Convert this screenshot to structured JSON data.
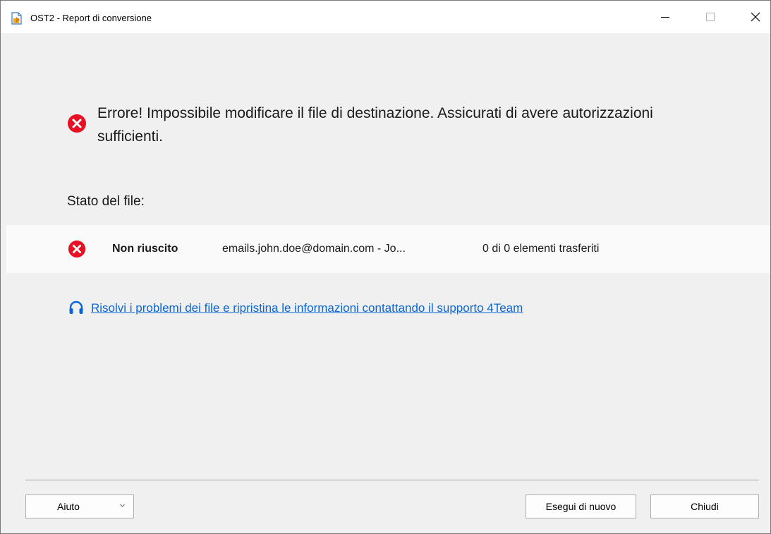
{
  "window": {
    "title": "OST2 - Report di conversione",
    "app_icon": "document-export-icon",
    "controls": [
      "minimize-icon",
      "maximize-icon",
      "close-icon"
    ]
  },
  "error": {
    "icon": "error-circle-icon",
    "message": "Errore! Impossibile modificare il file di destinazione. Assicurati di avere autorizzazioni sufficienti."
  },
  "file_status": {
    "label": "Stato del file:",
    "rows": [
      {
        "icon": "error-circle-icon",
        "status": "Non riuscito",
        "name": "emails.john.doe@domain.com - Jo...",
        "count": "0 di 0 elementi trasferiti"
      }
    ]
  },
  "support": {
    "icon": "headset-icon",
    "link_text": "Risolvi i problemi dei file e ripristina le informazioni contattando il supporto 4Team"
  },
  "footer": {
    "help_label": "Aiuto",
    "help_icon": "chevron-down-icon",
    "rerun_label": "Esegui di nuovo",
    "close_label": "Chiudi"
  },
  "colors": {
    "error_red": "#e81123",
    "link_blue": "#0a66d8",
    "background": "#f0f0f0",
    "row_background": "#fafafa"
  }
}
